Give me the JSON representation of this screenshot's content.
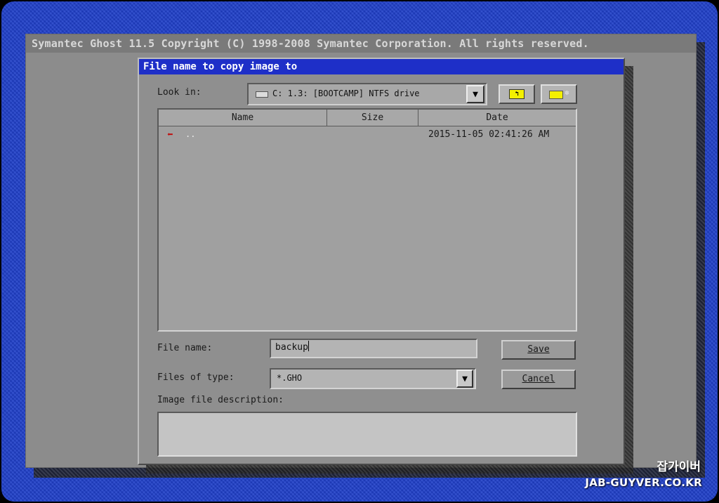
{
  "app": {
    "title": "Symantec Ghost 11.5   Copyright (C) 1998-2008 Symantec Corporation. All rights reserved."
  },
  "dialog": {
    "title": "File name to copy image to",
    "look_in_label": "Look in:",
    "look_in_value": "C: 1.3: [BOOTCAMP] NTFS drive",
    "toolbar": {
      "up_folder_icon": "folder-up-icon",
      "new_folder_icon": "new-folder-icon"
    },
    "file_list": {
      "columns": [
        "Name",
        "Size",
        "Date"
      ],
      "rows": [
        {
          "name": "..",
          "size": "",
          "date": "2015-11-05 02:41:26 AM"
        }
      ]
    },
    "file_name_label": "File name:",
    "file_name_value": "backup",
    "files_of_type_label": "Files of type:",
    "files_of_type_value": "*.GHO",
    "image_desc_label": "Image file description:",
    "image_desc_value": "",
    "save_label": "Save",
    "cancel_label": "Cancel"
  },
  "watermark": {
    "korean": "잡가이버",
    "domain": "JAB-GUYVER.CO.KR"
  },
  "colors": {
    "desktop": "#1f3fc9",
    "window": "#8c8c8c",
    "dialog_title": "#1e2fc8"
  }
}
